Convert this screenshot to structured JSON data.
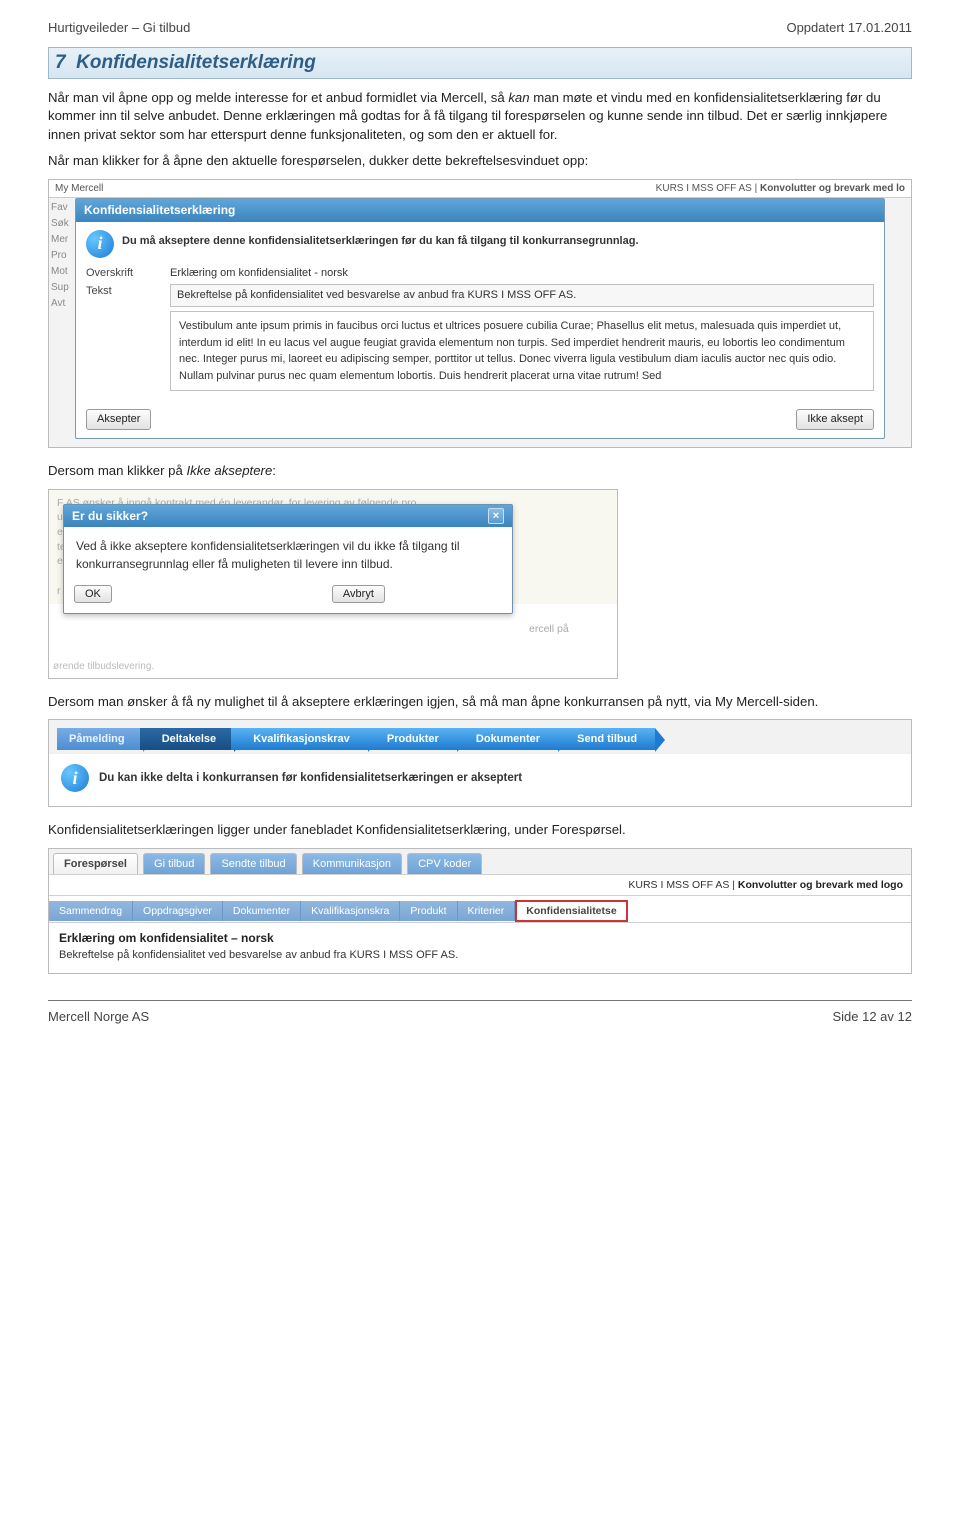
{
  "header": {
    "left": "Hurtigveileder – Gi tilbud",
    "right": "Oppdatert 17.01.2011"
  },
  "section": {
    "number": "7",
    "title": "Konfidensialitetserklæring"
  },
  "paragraphs": {
    "p1_a": "Når man vil åpne opp og melde interesse for et anbud formidlet via Mercell, så ",
    "p1_kan": "kan",
    "p1_b": " man møte et vindu med en konfidensialitetserklæring før du kommer inn til selve anbudet. Denne erklæringen må godtas for å få tilgang til forespørselen og kunne sende inn tilbud. Det er særlig innkjøpere innen privat sektor som har etterspurt denne funksjonaliteten, og som den er aktuell for.",
    "p2": "Når man klikker for å åpne den aktuelle forespørselen, dukker dette bekreftelsesvinduet opp:",
    "p3_a": "Dersom man klikker på ",
    "p3_em": "Ikke akseptere",
    "p3_b": ":",
    "p4": "Dersom man ønsker å få ny mulighet til å akseptere erklæringen igjen, så må man åpne konkurransen på nytt, via My Mercell-siden.",
    "p5": "Konfidensialitetserklæringen ligger under fanebladet Konfidensialitetserklæring, under Forespørsel."
  },
  "shot_conf": {
    "topleft": "My Mercell",
    "topright_a": "KURS I MSS OFF AS | ",
    "topright_b": "Konvolutter og brevark med lo",
    "side_items": [
      "Fav",
      "Søk",
      "Mer",
      "Pro",
      "Mot",
      "Sup",
      "Avt"
    ],
    "modal_title": "Konfidensialitetserklæring",
    "info_text": "Du må akseptere denne konfidensialitetserklæringen før du kan få tilgang til konkurransegrunnlag.",
    "label_overskrift": "Overskrift",
    "label_tekst": "Tekst",
    "val_overskrift": "Erklæring om konfidensialitet - norsk",
    "val_tekst_short": "Bekreftelse på konfidensialitet ved besvarelse av anbud fra KURS I MSS OFF AS.",
    "val_tekst_long": "Vestibulum ante ipsum primis in faucibus orci luctus et ultrices posuere cubilia Curae; Phasellus elit metus, malesuada quis imperdiet ut, interdum id elit! In eu lacus vel augue feugiat gravida elementum non turpis. Sed imperdiet hendrerit mauris, eu lobortis leo condimentum nec. Integer purus mi, laoreet eu adipiscing semper, porttitor ut tellus. Donec viverra ligula vestibulum diam iaculis auctor nec quis odio. Nullam pulvinar purus nec quam elementum lobortis. Duis hendrerit placerat urna vitae rutrum! Sed",
    "btn_accept": "Aksepter",
    "btn_reject": "Ikke aksept"
  },
  "shot_sure": {
    "bg_l1": "F AS ønsker å inngå kontrakt med én leverandør, for levering av følgende pro",
    "bg_right": "ercell på",
    "bottom_stub": "ørende tilbudslevering.",
    "title": "Er du sikker?",
    "body": "Ved å ikke akseptere konfidensialitetserklæringen vil du ikke få tilgang til konkurransegrunnlag eller få muligheten til levere inn tilbud.",
    "btn_ok": "OK",
    "btn_cancel": "Avbryt"
  },
  "shot_nav": {
    "items": [
      "Påmelding",
      "Deltakelse",
      "Kvalifikasjonskrav",
      "Produkter",
      "Dokumenter",
      "Send tilbud"
    ],
    "warn": "Du kan ikke delta i konkurransen før konfidensialitetserkæringen er akseptert"
  },
  "shot_tabs": {
    "row1": [
      "Forespørsel",
      "Gi tilbud",
      "Sendte tilbud",
      "Kommunikasjon",
      "CPV koder"
    ],
    "row1_active_index": 0,
    "titlebar_a": "KURS I MSS OFF AS | ",
    "titlebar_b": "Konvolutter og brevark med logo",
    "row2": [
      "Sammendrag",
      "Oppdragsgiver",
      "Dokumenter",
      "Kvalifikasjonskra",
      "Produkt",
      "Kriterier",
      "Konfidensialitetse"
    ],
    "row2_active_index": 6,
    "content_hdr": "Erklæring om konfidensialitet – norsk",
    "content_sub": "Bekreftelse på konfidensialitet ved besvarelse av anbud fra KURS I MSS OFF AS."
  },
  "footer": {
    "left": "Mercell Norge AS",
    "right": "Side 12 av 12"
  }
}
